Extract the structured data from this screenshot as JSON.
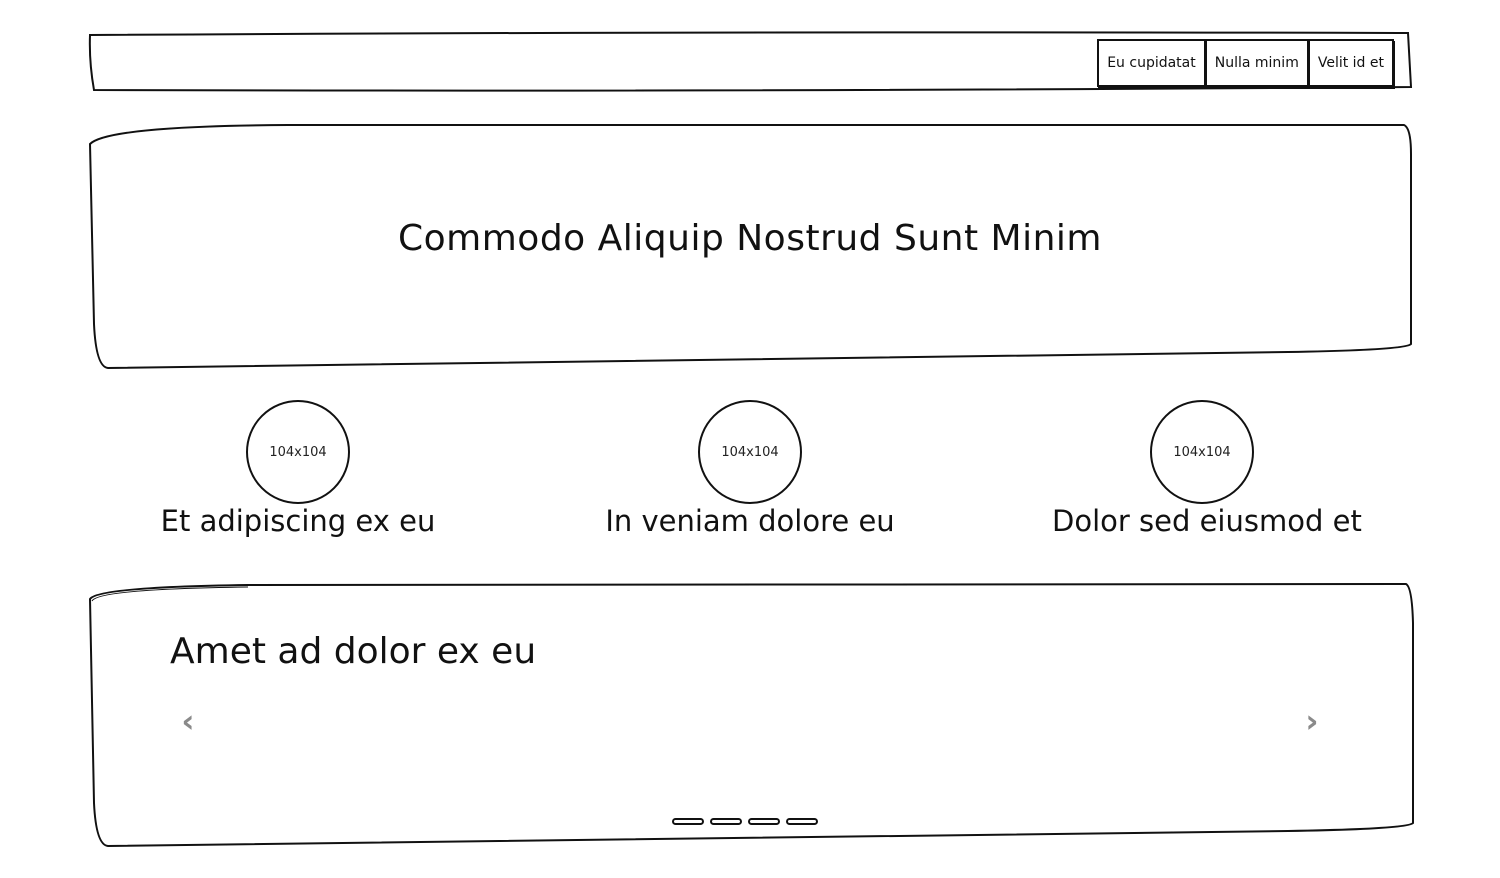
{
  "navbar": {
    "buttons": [
      {
        "label": "Eu cupidatat"
      },
      {
        "label": "Nulla minim"
      },
      {
        "label": "Velit id et"
      }
    ]
  },
  "hero": {
    "title": "Commodo Aliquip Nostrud Sunt Minim"
  },
  "features": [
    {
      "image_label": "104x104",
      "caption": "Et adipiscing ex eu"
    },
    {
      "image_label": "104x104",
      "caption": "In veniam dolore eu"
    },
    {
      "image_label": "104x104",
      "caption": "Dolor sed eiusmod et"
    }
  ],
  "carousel": {
    "title": "Amet ad dolor ex eu",
    "prev_icon": "chevron-left-icon",
    "next_icon": "chevron-right-icon",
    "slide_count": 4,
    "arrow_color": "#8a8a8a"
  }
}
